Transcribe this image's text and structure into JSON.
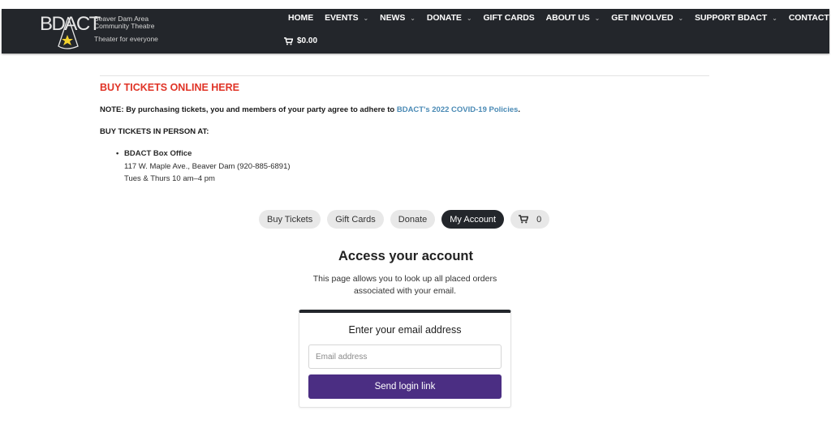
{
  "header": {
    "logo": {
      "mark": "BDACT",
      "name_line1": "Beaver Dam Area",
      "name_line2": "Community Theatre",
      "tagline": "Theater for everyone"
    },
    "nav": [
      {
        "label": "HOME",
        "dropdown": false
      },
      {
        "label": "EVENTS",
        "dropdown": true
      },
      {
        "label": "NEWS",
        "dropdown": true
      },
      {
        "label": "DONATE",
        "dropdown": true
      },
      {
        "label": "GIFT CARDS",
        "dropdown": false
      },
      {
        "label": "ABOUT US",
        "dropdown": true
      },
      {
        "label": "GET INVOLVED",
        "dropdown": true
      },
      {
        "label": "SUPPORT BDACT",
        "dropdown": true
      },
      {
        "label": "CONTACT US",
        "dropdown": true
      }
    ],
    "chevron": "⌄",
    "cart_total": "$0.00"
  },
  "content": {
    "buy_online": "BUY TICKETS ONLINE HERE",
    "note_prefix": "NOTE: By purchasing tickets, you and members of your party agree to adhere to ",
    "note_link": "BDACT's 2022 COVID-19 Policies",
    "note_suffix": ".",
    "in_person_heading": "BUY TICKETS IN PERSON AT:",
    "office": {
      "name": "BDACT Box Office",
      "address": "117 W. Maple Ave., Beaver Dam (920-885-6891)",
      "hours": "Tues & Thurs 10 am–4 pm"
    }
  },
  "pills": {
    "buy_tickets": "Buy Tickets",
    "gift_cards": "Gift Cards",
    "donate": "Donate",
    "my_account": "My Account",
    "cart_count": "0"
  },
  "account": {
    "title": "Access your account",
    "description": "This page allows you to look up all placed orders associated with your email.",
    "card_title": "Enter your email address",
    "email_placeholder": "Email address",
    "email_value": "",
    "send_button": "Send login link"
  },
  "colors": {
    "header_bg": "#23262b",
    "accent_red": "#e03427",
    "link_blue": "#4a8ab5",
    "button_purple": "#4b2e83"
  }
}
